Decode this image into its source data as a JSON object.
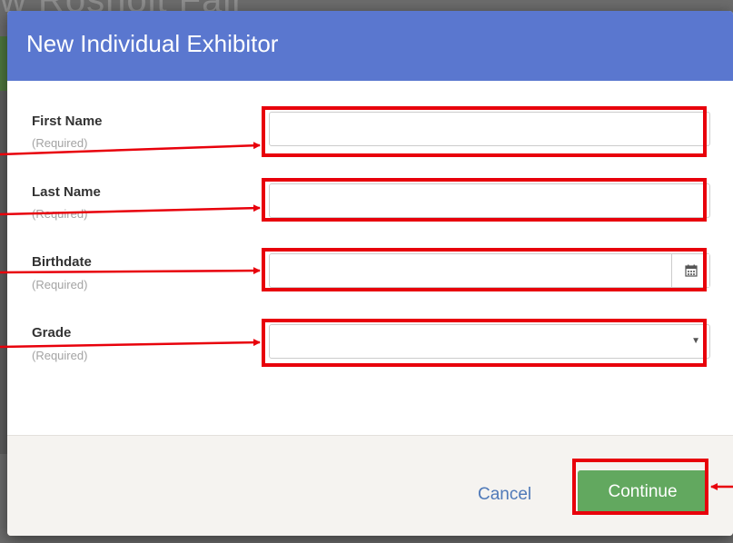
{
  "background": {
    "title_fragment": "w Rosholt Fair"
  },
  "modal": {
    "title": "New Individual Exhibitor",
    "fields": [
      {
        "label": "First Name",
        "hint": "(Required)",
        "value": "",
        "type": "text"
      },
      {
        "label": "Last Name",
        "hint": "(Required)",
        "value": "",
        "type": "text"
      },
      {
        "label": "Birthdate",
        "hint": "(Required)",
        "value": "",
        "type": "date"
      },
      {
        "label": "Grade",
        "hint": "(Required)",
        "value": "",
        "type": "select"
      }
    ],
    "footer": {
      "cancel_label": "Cancel",
      "continue_label": "Continue"
    }
  },
  "icons": {
    "calendar": "calendar-icon",
    "dropdown": "caret-down-icon"
  },
  "colors": {
    "header": "#5a77cf",
    "continue": "#62a85f",
    "cancel_link": "#4f79b8",
    "annotation": "#e8000b"
  }
}
